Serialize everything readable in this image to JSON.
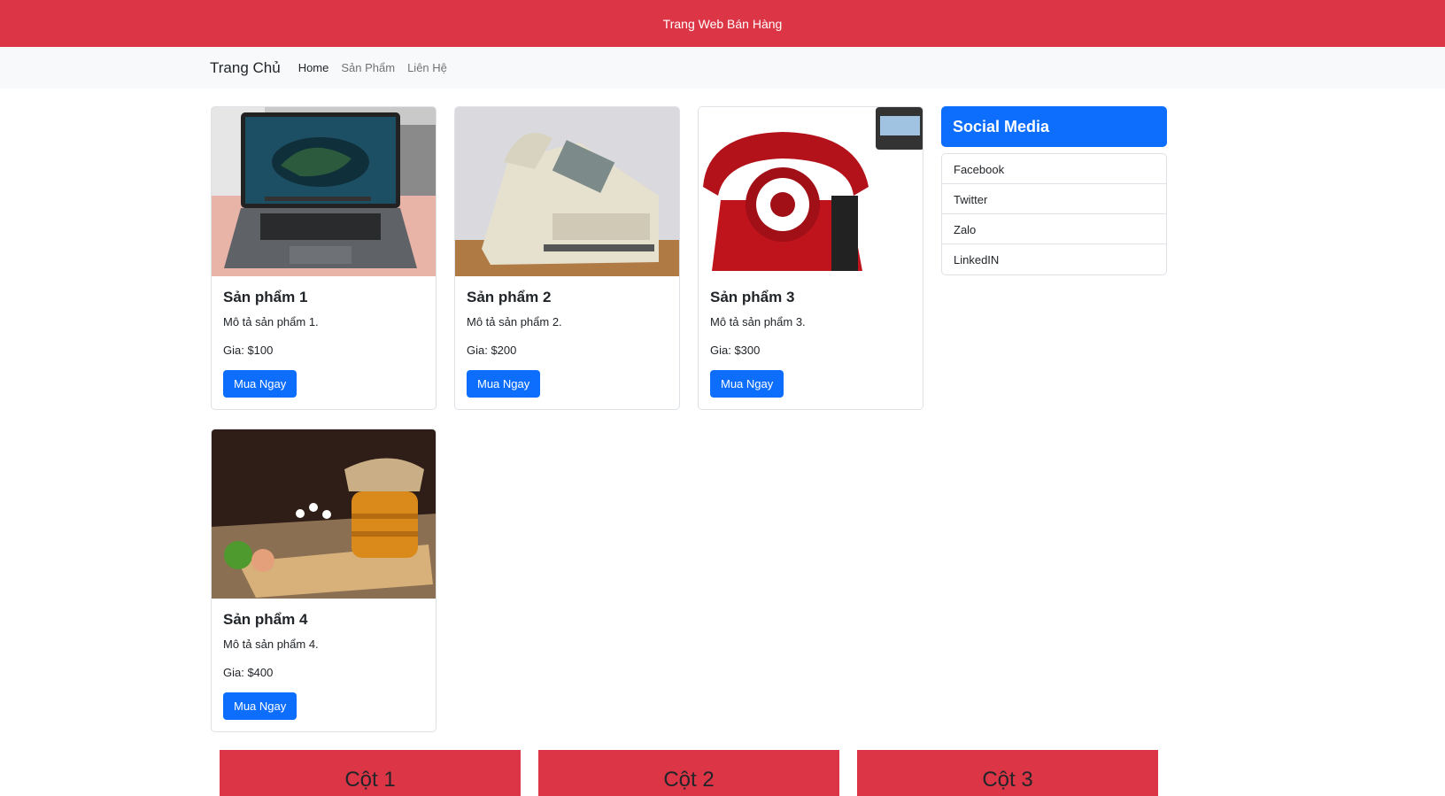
{
  "topbar": {
    "title": "Trang Web Bán Hàng"
  },
  "navbar": {
    "brand": "Trang Chủ",
    "links": [
      {
        "label": "Home",
        "active": true
      },
      {
        "label": "Sản Phẩm",
        "active": false
      },
      {
        "label": "Liên Hệ",
        "active": false
      }
    ]
  },
  "products": [
    {
      "title": "Sản phẩm 1",
      "description": "Mô tả sản phẩm 1.",
      "price": "Gia: $100",
      "button": "Mua Ngay",
      "image": "laptop-image"
    },
    {
      "title": "Sản phẩm 2",
      "description": "Mô tả sản phẩm 2.",
      "price": "Gia: $200",
      "button": "Mua Ngay",
      "image": "fax-machine-image"
    },
    {
      "title": "Sản phẩm 3",
      "description": "Mô tả sản phẩm 3.",
      "price": "Gia: $300",
      "button": "Mua Ngay",
      "image": "red-telephone-image"
    },
    {
      "title": "Sản phẩm 4",
      "description": "Mô tả sản phẩm 4.",
      "price": "Gia: $400",
      "button": "Mua Ngay",
      "image": "honey-jar-image"
    }
  ],
  "social": {
    "heading": "Social Media",
    "items": [
      "Facebook",
      "Twitter",
      "Zalo",
      "LinkedIN"
    ]
  },
  "columns": [
    "Cột 1",
    "Cột 2",
    "Cột 3"
  ],
  "colors": {
    "header": "#dc3545",
    "primary": "#0d6efd",
    "navbar": "#f8f9fa"
  }
}
